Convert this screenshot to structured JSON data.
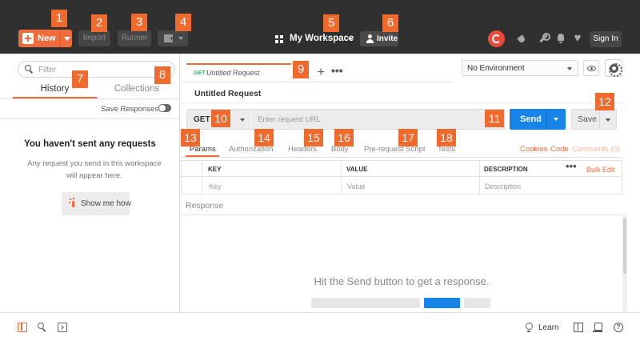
{
  "header": {
    "new_label": "New",
    "import_label": "Import",
    "runner_label": "Runner",
    "workspace_label": "My Workspace",
    "invite_label": "Invite",
    "signin_label": "Sign In",
    "icons": [
      "plus-icon",
      "new-window-icon",
      "grid-icon",
      "invite-icon",
      "sync-icon",
      "satellite-icon",
      "wrench-icon",
      "bell-icon",
      "heart-icon"
    ],
    "accent_color": "#f26b3a",
    "sync_color": "#e84b3c"
  },
  "sidebar": {
    "filter_placeholder": "Filter",
    "tabs": [
      {
        "label": "History",
        "active": true
      },
      {
        "label": "Collections",
        "active": false
      }
    ],
    "save_responses_label": "Save Responses",
    "empty_title": "You haven't sent any requests",
    "empty_desc": "Any request you send in this workspace will appear here.",
    "show_me_label": "Show me how"
  },
  "main": {
    "tab": {
      "method": "GET",
      "title": "Untitled Request"
    },
    "more_label": "•••",
    "add_label": "+",
    "environment": "No Environment",
    "request_title": "Untitled Request",
    "method": "GET",
    "url_placeholder": "Enter request URL",
    "send_label": "Send",
    "save_label": "Save",
    "send_color": "#1883e6",
    "sub_tabs": [
      "Params",
      "Authorization",
      "Headers",
      "Body",
      "Pre-request Script",
      "Tests"
    ],
    "sub_right": {
      "cookies": "Cookies",
      "code": "Code",
      "comments": "Comments (0)"
    },
    "params_table": {
      "columns": [
        "KEY",
        "VALUE",
        "DESCRIPTION"
      ],
      "placeholders": [
        "Key",
        "Value",
        "Description"
      ],
      "more_label": "•••",
      "bulk_edit_label": "Bulk Edit"
    },
    "response_label": "Response",
    "response_message": "Hit the Send button to get a response."
  },
  "statusbar": {
    "learn_label": "Learn",
    "help_label": "?"
  },
  "callouts": [
    "1",
    "2",
    "3",
    "4",
    "5",
    "6",
    "7",
    "8",
    "9",
    "10",
    "11",
    "12",
    "13",
    "14",
    "15",
    "16",
    "17",
    "18"
  ]
}
